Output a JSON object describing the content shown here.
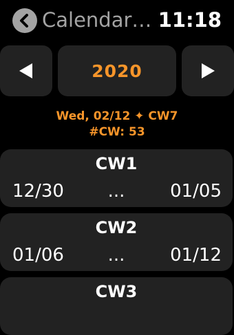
{
  "header": {
    "title": "Calendar…",
    "time": "11:18",
    "back_icon": "chevron-left-icon"
  },
  "year_nav": {
    "year": "2020",
    "prev_icon": "triangle-left-icon",
    "next_icon": "triangle-right-icon"
  },
  "info": {
    "date_line": "Wed, 02/12 ✦ CW7",
    "cw_count": "#CW: 53"
  },
  "weeks": [
    {
      "label": "CW1",
      "start": "12/30",
      "dots": "...",
      "end": "01/05"
    },
    {
      "label": "CW2",
      "start": "01/06",
      "dots": "...",
      "end": "01/12"
    },
    {
      "label": "CW3",
      "start": "",
      "dots": "",
      "end": ""
    }
  ],
  "colors": {
    "accent": "#f7952a",
    "card": "#222222",
    "muted": "#a3a3a3",
    "background": "#000000"
  }
}
